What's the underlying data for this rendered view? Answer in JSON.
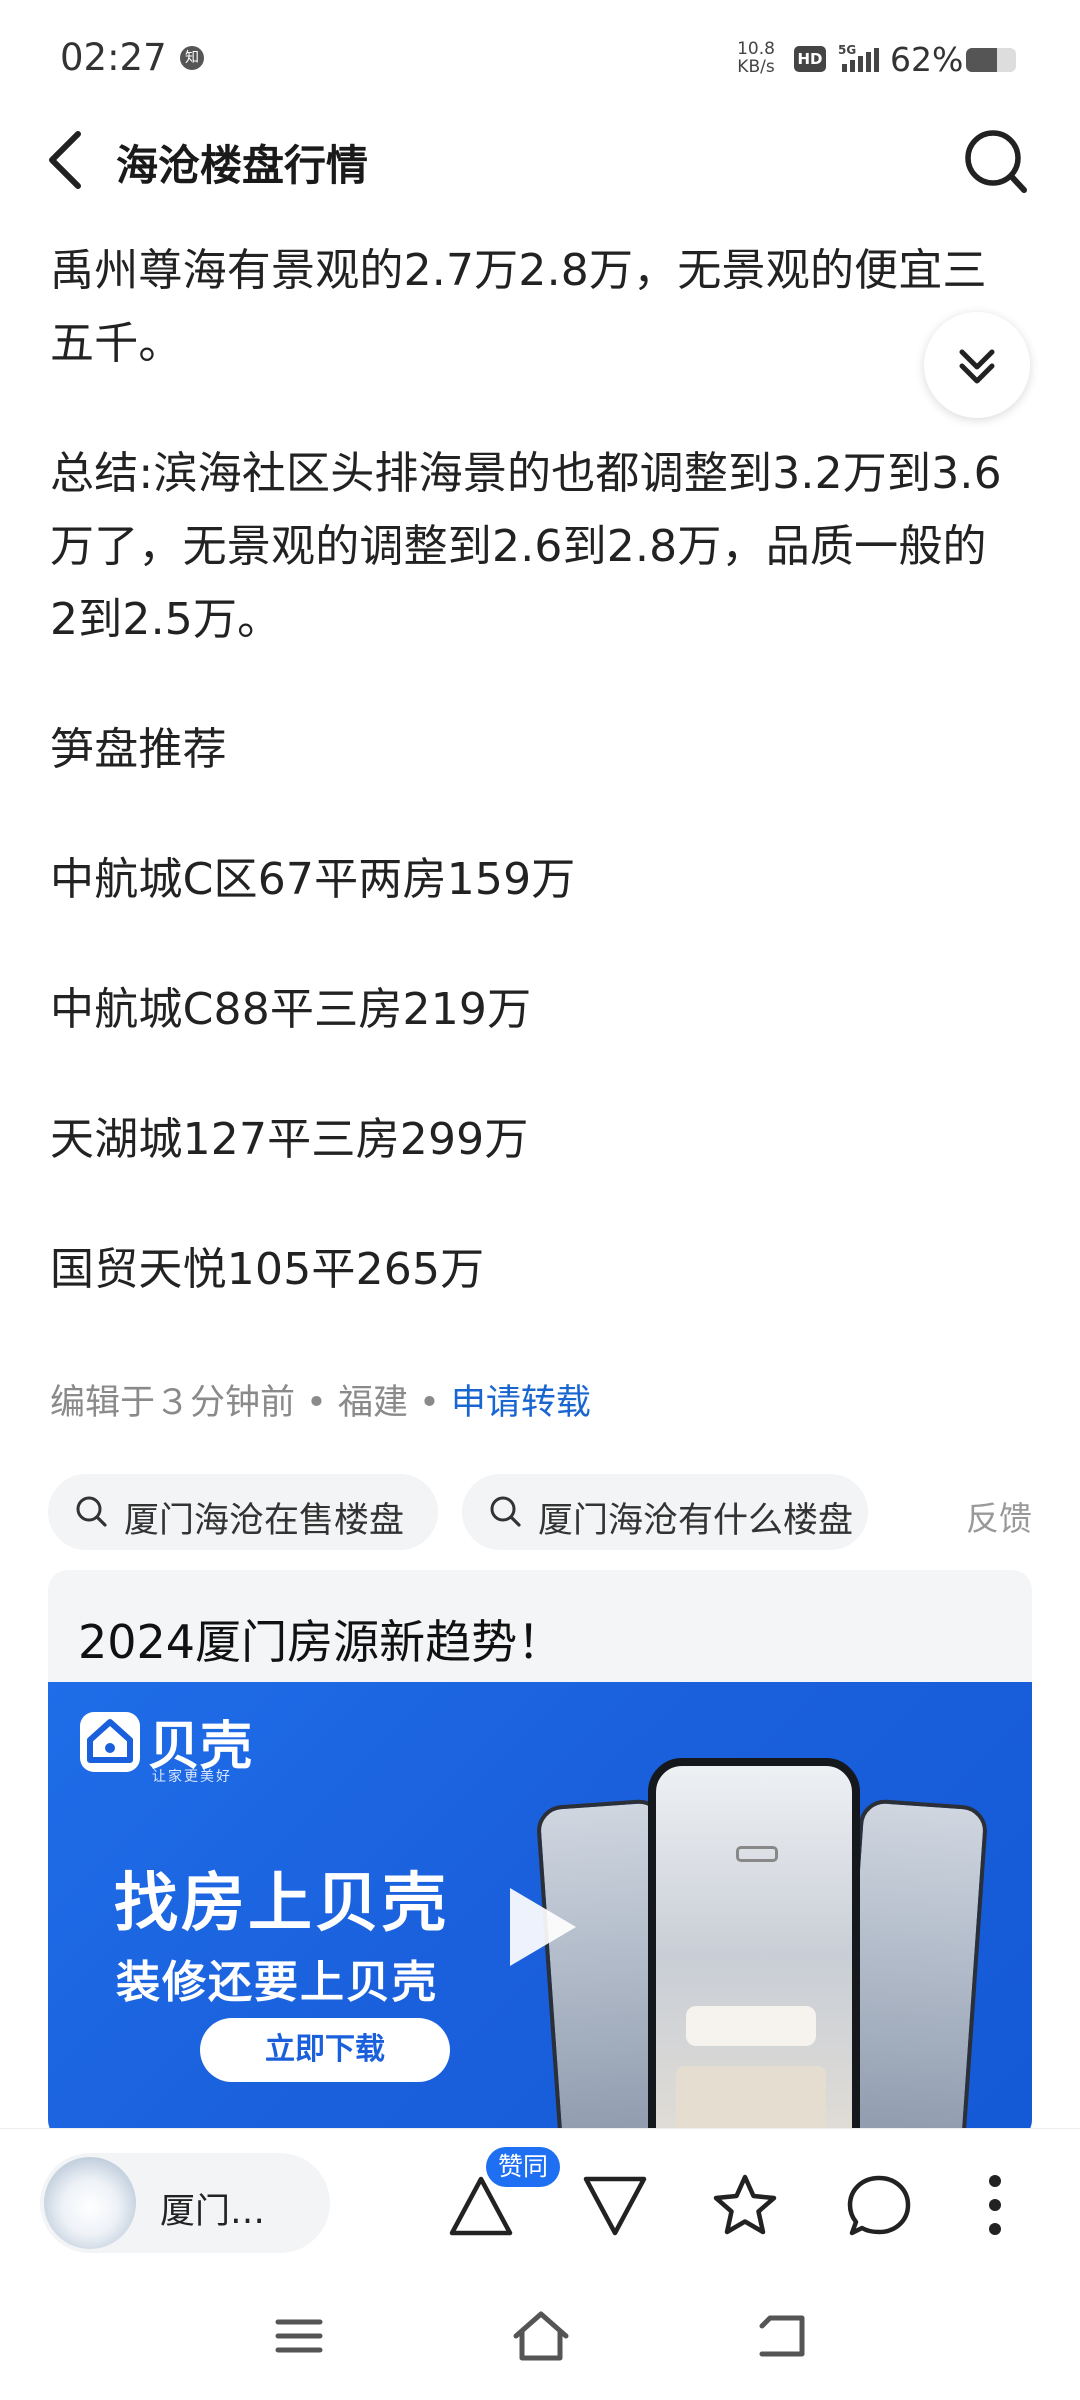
{
  "status_bar": {
    "time": "02:27",
    "app_badge": "知",
    "net_speed_value": "10.8",
    "net_speed_unit": "KB/s",
    "hd_label": "HD",
    "network_type": "5G",
    "battery": "62%",
    "battery_level": 0.62
  },
  "header": {
    "title": "海沧楼盘行情"
  },
  "article": {
    "paragraphs": [
      "禹州尊海有景观的2.7万2.8万，无景观的便宜三五千。",
      "总结:滨海社区头排海景的也都调整到3.2万到3.6万了，无景观的调整到2.6到2.8万，品质一般的2到2.5万。",
      "笋盘推荐",
      "中航城C区67平两房159万",
      "中航城C88平三房219万",
      "天湖城127平三房299万",
      "国贸天悦105平265万"
    ]
  },
  "meta": {
    "edited": "编辑于３分钟前",
    "location": "福建",
    "repost_link": "申请转载",
    "separator": "•"
  },
  "related_searches": {
    "chips": [
      "厦门海沧在售楼盘",
      "厦门海沧有什么楼盘"
    ],
    "feedback": "反馈"
  },
  "ad": {
    "title": "2024厦门房源新趋势！",
    "brand_name": "贝壳",
    "brand_slogan": "让家更美好",
    "headline_1": "找房上贝壳",
    "headline_2": "装修还要上贝壳",
    "cta": "立即下载"
  },
  "bottom_bar": {
    "author_name": "厦门…",
    "upvote_badge": "赞同",
    "icons": [
      "upvote-icon",
      "downvote-icon",
      "star-icon",
      "comment-icon",
      "more-icon"
    ]
  },
  "system_nav": {
    "icons": [
      "menu-icon",
      "home-icon",
      "back-icon"
    ]
  },
  "colors": {
    "link": "#1a66d1",
    "badge": "#1e6ff1",
    "ad_background": "#1a5fdc"
  }
}
